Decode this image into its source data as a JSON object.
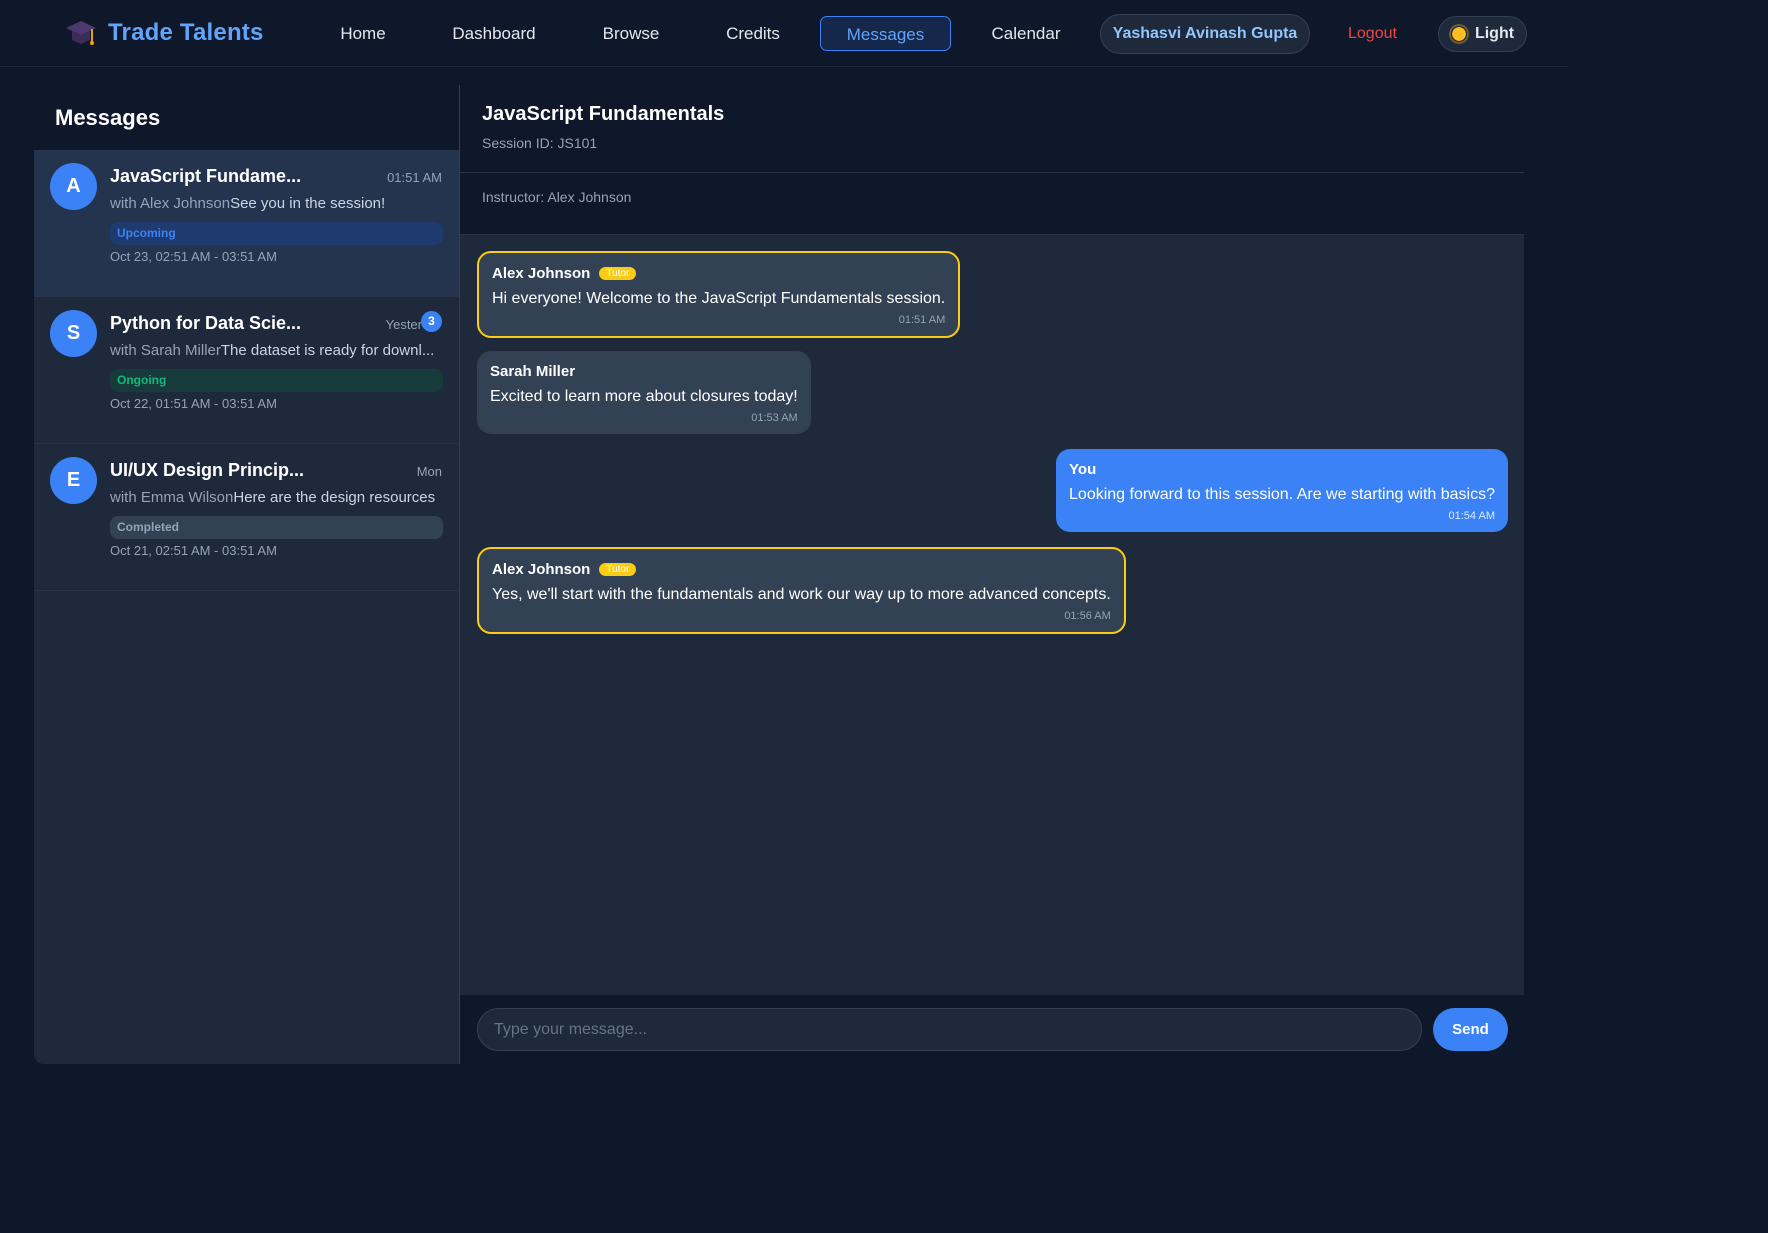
{
  "nav": {
    "brand": "Trade Talents",
    "links": [
      "Home",
      "Dashboard",
      "Browse",
      "Credits",
      "Messages",
      "Calendar"
    ],
    "active": "Messages",
    "user": "Yashasvi Avinash Gupta",
    "logout": "Logout",
    "theme_label": "Light",
    "colors": {
      "accent": "#3b82f6",
      "brand": "#60a5fa",
      "logout": "#ef4444"
    }
  },
  "sidebar": {
    "title": "Messages",
    "conversations": [
      {
        "avatar": "A",
        "title": "JavaScript Fundame...",
        "time": "01:51 AM",
        "with": "with Alex Johnson",
        "last": "See you in the session!",
        "status": "Upcoming",
        "range": "Oct 23, 02:51 AM - 03:51 AM",
        "active": true
      },
      {
        "avatar": "S",
        "title": "Python for Data Scie...",
        "time": "Yester",
        "unread": "3",
        "with": "with Sarah Miller",
        "last": "The dataset is ready for downl...",
        "status": "Ongoing",
        "range": "Oct 22, 01:51 AM - 03:51 AM"
      },
      {
        "avatar": "E",
        "title": "UI/UX Design Princip...",
        "time": "Mon",
        "with": "with Emma Wilson",
        "last": "Here are the design resources",
        "status": "Completed",
        "range": "Oct 21, 02:51 AM - 03:51 AM"
      }
    ]
  },
  "chat": {
    "title": "JavaScript Fundamentals",
    "session": "Session ID: JS101",
    "instructor": "Instructor: Alex Johnson",
    "tutor_tag": "Tutor",
    "messages": [
      {
        "sender": "Alex Johnson",
        "tutor": true,
        "text": "Hi everyone! Welcome to the JavaScript Fundamentals session.",
        "time": "01:51 AM"
      },
      {
        "sender": "Sarah Miller",
        "text": "Excited to learn more about closures today!",
        "time": "01:53 AM"
      },
      {
        "sender": "You",
        "mine": true,
        "text": "Looking forward to this session. Are we starting with basics?",
        "time": "01:54 AM"
      },
      {
        "sender": "Alex Johnson",
        "tutor": true,
        "text": "Yes, we'll start with the fundamentals and work our way up to more advanced concepts.",
        "time": "01:56 AM"
      }
    ],
    "input_placeholder": "Type your message...",
    "send_label": "Send",
    "colors": {
      "tutor_border": "#facc15",
      "mine_bubble": "#3b82f6"
    }
  }
}
